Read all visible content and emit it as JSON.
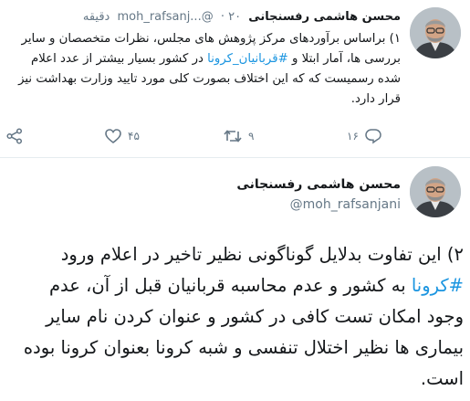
{
  "tweet1": {
    "author_name": "محسن هاشمی رفسنجانی",
    "handle": "moh_rafsanj...@",
    "separator": "·",
    "time": "۲۰ دقیقه",
    "text_before_tag": "۱) براساس برآوردهای مرکز پژوهش های مجلس، نظرات متخصصان و سایر بررسی ها، آمار ابتلا و ",
    "hashtag": "#قربانیان_کرونا",
    "text_after_tag": " در کشور بسیار بیشتر از عدد اعلام شده رسمیست که که این اختلاف بصورت کلی مورد تایید وزارت بهداشت نیز قرار دارد.",
    "reply_count": "۱۶",
    "retweet_count": "۹",
    "like_count": "۴۵"
  },
  "tweet2": {
    "author_name": "محسن هاشمی رفسنجانی",
    "handle": "@moh_rafsanjani",
    "text_before_tag": "۲) این تفاوت بدلایل گوناگونی نظیر تاخیر در اعلام ورود ",
    "hashtag": "#کرونا",
    "text_after_tag": " به کشور و عدم محاسبه قربانیان قبل از آن، عدم وجود امکان تست کافی در کشور و عنوان کردن نام سایر بیماری ها نظیر اختلال تنفسی و شبه کرونا بعنوان کرونا بوده است."
  },
  "colors": {
    "text": "#14171a",
    "secondary": "#657786",
    "link": "#1b95e0",
    "divider": "#e6ecf0"
  },
  "icons": [
    "reply-icon",
    "retweet-icon",
    "like-icon",
    "share-icon"
  ]
}
